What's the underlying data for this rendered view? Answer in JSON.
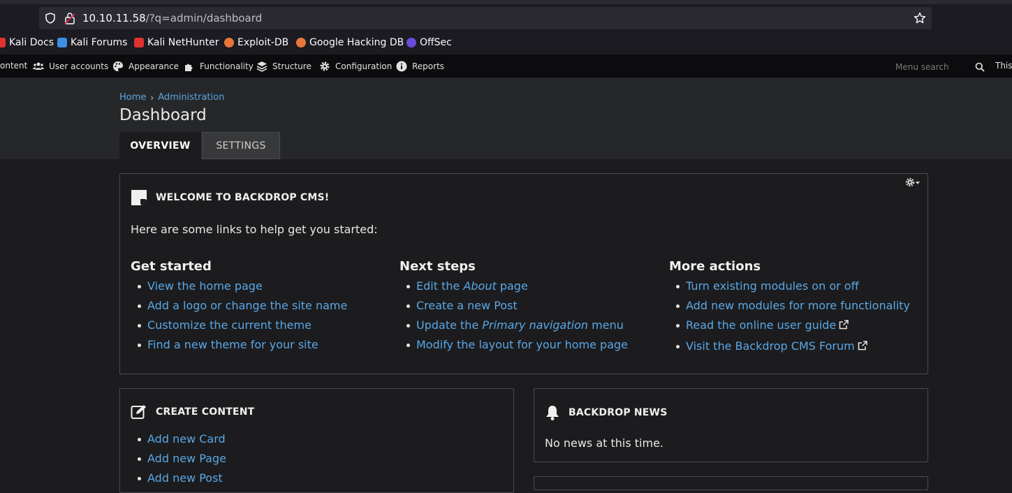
{
  "browser": {
    "url_host": "10.10.11.58",
    "url_path": "/?q=admin/dashboard",
    "bookmarks": [
      {
        "label": "Kali Docs",
        "icon": "kali-docs-icon",
        "color": "#e0322f"
      },
      {
        "label": "Kali Forums",
        "icon": "kali-forums-icon",
        "color": "#3c8fe3"
      },
      {
        "label": "Kali NetHunter",
        "icon": "kali-nethunter-icon",
        "color": "#e0322f"
      },
      {
        "label": "Exploit-DB",
        "icon": "exploit-db-icon",
        "color": "#e8763a"
      },
      {
        "label": "Google Hacking DB",
        "icon": "ghdb-icon",
        "color": "#e8763a"
      },
      {
        "label": "OffSec",
        "icon": "offsec-icon",
        "color": "#6a4ad9"
      }
    ]
  },
  "adminbar": {
    "items": [
      {
        "label": "ontent",
        "icon": "content-icon"
      },
      {
        "label": "User accounts",
        "icon": "users-icon"
      },
      {
        "label": "Appearance",
        "icon": "palette-icon"
      },
      {
        "label": "Functionality",
        "icon": "puzzle-icon"
      },
      {
        "label": "Structure",
        "icon": "layers-icon"
      },
      {
        "label": "Configuration",
        "icon": "gear-icon"
      },
      {
        "label": "Reports",
        "icon": "info-icon"
      }
    ],
    "search_placeholder": "Menu search",
    "trailing": "This"
  },
  "header": {
    "breadcrumb": [
      "Home",
      "Administration"
    ],
    "title": "Dashboard",
    "tabs": [
      "OVERVIEW",
      "SETTINGS"
    ]
  },
  "welcome": {
    "title": "WELCOME TO BACKDROP CMS!",
    "intro": "Here are some links to help get you started:",
    "columns": [
      {
        "heading": "Get started",
        "links": [
          "View the home page",
          "Add a logo or change the site name",
          "Customize the current theme",
          "Find a new theme for your site"
        ]
      },
      {
        "heading": "Next steps",
        "links": [
          "Edit the ",
          "About",
          " page",
          "Create a new Post",
          "Update the ",
          "Primary navigation",
          " menu",
          "Modify the layout for your home page"
        ]
      },
      {
        "heading": "More actions",
        "links": [
          "Turn existing modules on or off",
          "Add new modules for more functionality",
          "Read the online user guide",
          "Visit the Backdrop CMS Forum"
        ]
      }
    ]
  },
  "create_content": {
    "title": "CREATE CONTENT",
    "links": [
      "Add new Card",
      "Add new Page",
      "Add new Post"
    ]
  },
  "news": {
    "title": "BACKDROP NEWS",
    "text": "No news at this time."
  },
  "colors": {
    "link": "#5aa7e6",
    "background": "#1c1c1e",
    "header": "#262729"
  }
}
